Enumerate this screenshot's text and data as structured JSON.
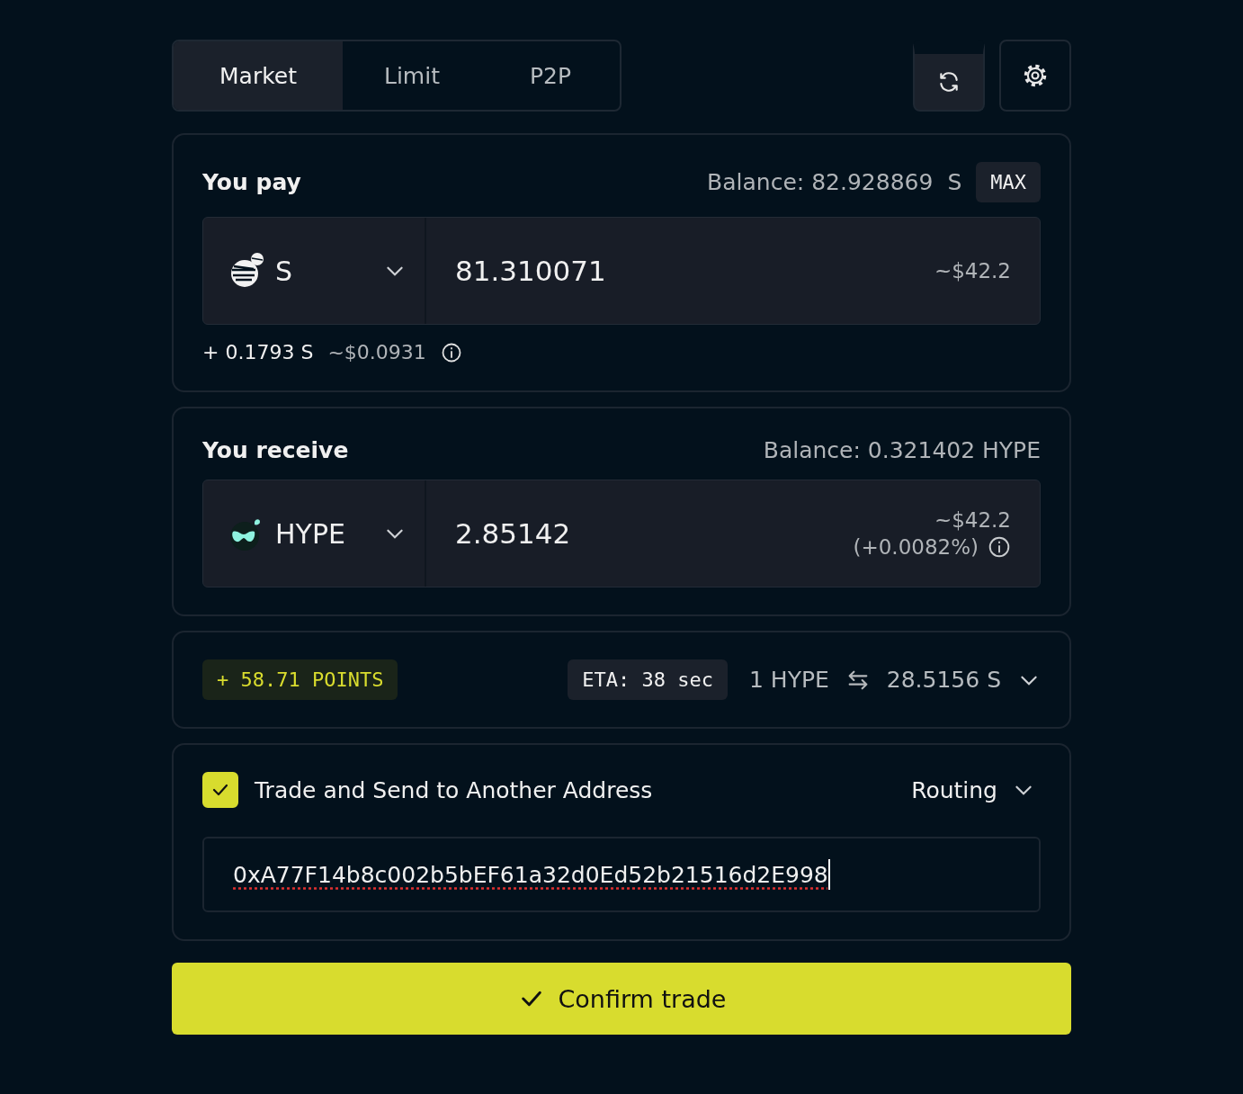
{
  "tabs": [
    {
      "label": "Market",
      "selected": true
    },
    {
      "label": "Limit",
      "selected": false
    },
    {
      "label": "P2P",
      "selected": false
    }
  ],
  "pay": {
    "title": "You pay",
    "balance_label": "Balance: 82.928869",
    "balance_unit": "S",
    "max": "MAX",
    "token": "S",
    "amount": "81.310071",
    "usd": "~$42.2",
    "bonus": "+ 0.1793 S",
    "bonus_usd": "~$0.0931"
  },
  "receive": {
    "title": "You receive",
    "balance": "Balance: 0.321402 HYPE",
    "token": "HYPE",
    "amount": "2.85142",
    "usd": "~$42.2",
    "impact": "(+0.0082%)"
  },
  "info": {
    "points": "+ 58.71 POINTS",
    "eta": "ETA: 38 sec",
    "rate_from": "1 HYPE",
    "rate_to": "28.5156 S"
  },
  "send": {
    "checked": true,
    "label": "Trade and Send to Another Address",
    "routing": "Routing",
    "address": "0xA77F14b8c002b5bEF61a32d0Ed52b21516d2E998"
  },
  "confirm": "Confirm trade"
}
